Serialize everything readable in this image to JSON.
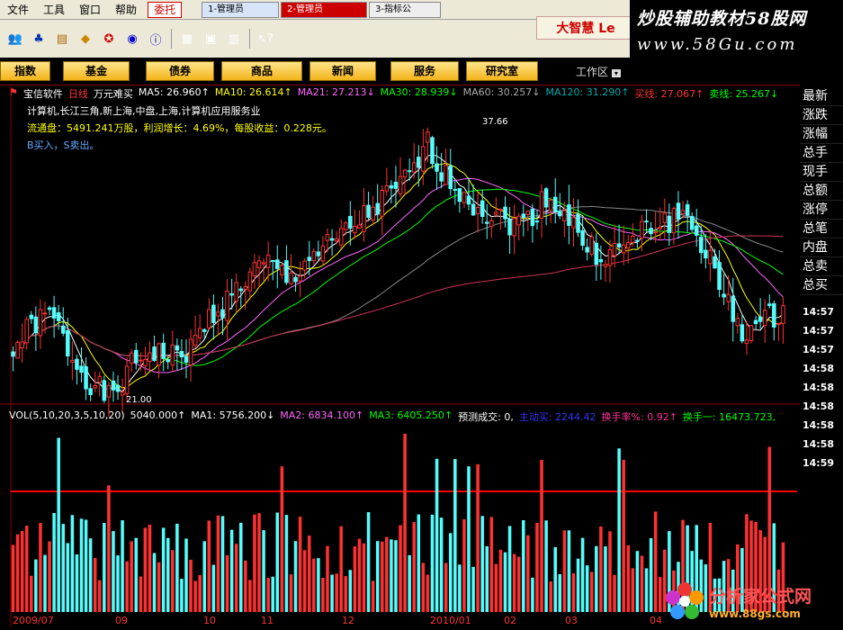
{
  "menubar": {
    "items": [
      "文件",
      "工具",
      "窗口",
      "帮助"
    ],
    "trade_label": "委托",
    "tasks": [
      "1-管理员",
      "2-管理员",
      "3-指标公"
    ]
  },
  "brand_logo": "大智慧 Le",
  "watermark_top": {
    "line1": "炒股辅助教材58股网",
    "line2": "www.58Gu.com"
  },
  "nav": {
    "buttons": [
      "指数",
      "基金",
      "债券",
      "商品",
      "新闻",
      "服务",
      "研究室"
    ],
    "workarea": "工作区"
  },
  "stock": {
    "name": "宝信软件",
    "period": "日线",
    "hint": "万元难买",
    "ma": [
      {
        "t": "MA5: 26.960↑",
        "c": "#ffffff"
      },
      {
        "t": "MA10: 26.614↑",
        "c": "#ffff00"
      },
      {
        "t": "MA21: 27.213↓",
        "c": "#ff66ff"
      },
      {
        "t": "MA30: 28.939↓",
        "c": "#00ff00"
      },
      {
        "t": "MA60: 30.257↓",
        "c": "#aaaaaa"
      },
      {
        "t": "MA120: 31.290↑",
        "c": "#00aaaa"
      },
      {
        "t": "买线: 27.067↑",
        "c": "#ff3333"
      },
      {
        "t": "卖线: 25.267↓",
        "c": "#00ff00"
      }
    ],
    "info_line1": "计算机,长江三角,新上海,中盘,上海,计算机应用服务业",
    "info_line2": "流通盘：5491.241万股，利润增长：4.69%，每股收益：0.228元。",
    "info_line3": "B买入，S卖出。",
    "high_label": "37.66",
    "low_label": "21.00"
  },
  "volume": {
    "params": "VOL(5,10,20,3,5,10,20)",
    "values": [
      {
        "t": "5040.000↑",
        "c": "#ffffff"
      },
      {
        "t": "MA1: 5756.200↓",
        "c": "#ffffff"
      },
      {
        "t": "MA2: 6834.100↑",
        "c": "#ff66ff"
      },
      {
        "t": "MA3: 6405.250↑",
        "c": "#00ff00"
      },
      {
        "t": "预测成交: 0,",
        "c": "#ffffff"
      },
      {
        "t": "主动买: 2244.42",
        "c": "#3333ff"
      },
      {
        "t": "换手率%: 0.92↑",
        "c": "#ff3399"
      },
      {
        "t": "换手一: 16473.723,",
        "c": "#00ff00"
      }
    ]
  },
  "x_axis_labels": [
    "2009/07",
    "09",
    "10",
    "11",
    "12",
    "2010/01",
    "02",
    "03",
    "04"
  ],
  "right_panel": {
    "items": [
      "最新",
      "涨跌",
      "涨幅",
      "总手",
      "现手",
      "总额",
      "涨停",
      "总笔",
      "内盘",
      "总卖",
      "总买"
    ],
    "times": [
      "14:57",
      "14:57",
      "14:57",
      "14:58",
      "14:58",
      "14:58",
      "14:58",
      "14:58",
      "14:59"
    ]
  },
  "watermark_bottom": {
    "line1": "分析家公式网",
    "line2": "www.88gs.com"
  },
  "chart_data": {
    "type": "candlestick",
    "title": "宝信软件 日线",
    "x_ticks": [
      "2009/07",
      "09",
      "10",
      "11",
      "12",
      "2010/01",
      "02",
      "03",
      "04"
    ],
    "approx_close": [
      24,
      25.5,
      26,
      23.5,
      22,
      21,
      23,
      24,
      23.5,
      24,
      26,
      27,
      28.5,
      29,
      28,
      29.5,
      30,
      31,
      32,
      33,
      34,
      36,
      34,
      33,
      32,
      31.5,
      31.5,
      33,
      32,
      30,
      29.5,
      30,
      31,
      31.5,
      32,
      30,
      27,
      25,
      25.5,
      26.5
    ],
    "high": 37.66,
    "low": 21.0
  }
}
